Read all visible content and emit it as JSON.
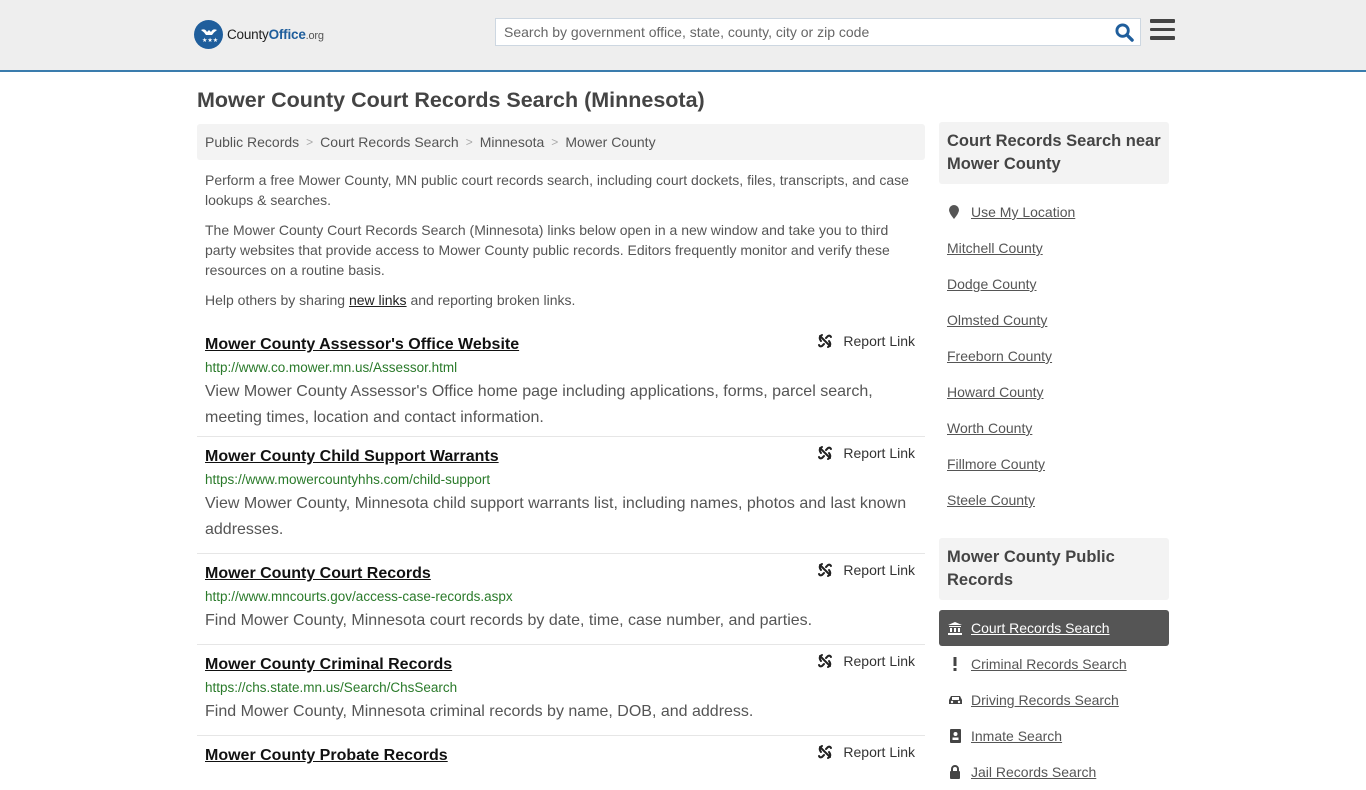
{
  "header": {
    "logo": {
      "text_main": "County",
      "text_brand": "Office",
      "text_tld": ".org"
    },
    "search": {
      "placeholder": "Search by government office, state, county, city or zip code",
      "value": ""
    },
    "menu_icon": "hamburger-icon",
    "search_icon": "search-icon"
  },
  "colors": {
    "brand_blue": "#1f5e9c",
    "header_border": "#3a7cad",
    "url_green": "#2a7a2a",
    "active_item_bg": "#555555"
  },
  "page": {
    "title": "Mower County Court Records Search (Minnesota)",
    "breadcrumb": [
      "Public Records",
      "Court Records Search",
      "Minnesota",
      "Mower County"
    ],
    "intro": {
      "p1": "Perform a free Mower County, MN public court records search, including court dockets, files, transcripts, and case lookups & searches.",
      "p2": "The Mower County Court Records Search (Minnesota) links below open in a new window and take you to third party websites that provide access to Mower County public records. Editors frequently monitor and verify these resources on a routine basis.",
      "p3_before": "Help others by sharing ",
      "p3_link": "new links",
      "p3_after": " and reporting broken links."
    },
    "report_label": "Report Link",
    "records": [
      {
        "title": "Mower County Assessor's Office Website",
        "url": "http://www.co.mower.mn.us/Assessor.html",
        "desc": "View Mower County Assessor's Office home page including applications, forms, parcel search, meeting times, location and contact information."
      },
      {
        "title": "Mower County Child Support Warrants",
        "url": "https://www.mowercountyhhs.com/child-support",
        "desc": "View Mower County, Minnesota child support warrants list, including names, photos and last known addresses."
      },
      {
        "title": "Mower County Court Records",
        "url": "http://www.mncourts.gov/access-case-records.aspx",
        "desc": "Find Mower County, Minnesota court records by date, time, case number, and parties."
      },
      {
        "title": "Mower County Criminal Records",
        "url": "https://chs.state.mn.us/Search/ChsSearch",
        "desc": "Find Mower County, Minnesota criminal records by name, DOB, and address."
      },
      {
        "title": "Mower County Probate Records",
        "url": "",
        "desc": ""
      }
    ]
  },
  "sidebar": {
    "nearby_heading": "Court Records Search near Mower County",
    "use_location": "Use My Location",
    "nearby": [
      "Mitchell County",
      "Dodge County",
      "Olmsted County",
      "Freeborn County",
      "Howard County",
      "Worth County",
      "Fillmore County",
      "Steele County"
    ],
    "public_records_heading": "Mower County Public Records",
    "public_records": [
      {
        "label": "Court Records Search",
        "icon": "courthouse-icon",
        "active": true
      },
      {
        "label": "Criminal Records Search",
        "icon": "exclamation-icon",
        "active": false
      },
      {
        "label": "Driving Records Search",
        "icon": "car-icon",
        "active": false
      },
      {
        "label": "Inmate Search",
        "icon": "id-badge-icon",
        "active": false
      },
      {
        "label": "Jail Records Search",
        "icon": "lock-icon",
        "active": false
      }
    ]
  }
}
